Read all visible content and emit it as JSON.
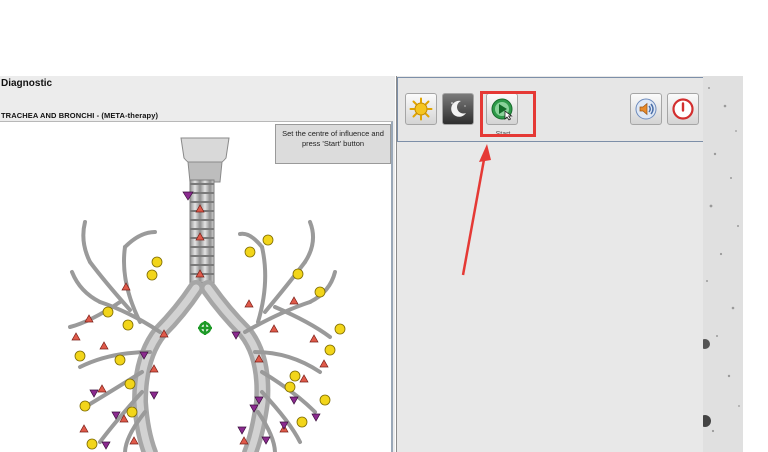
{
  "window": {
    "title": "Diagnostic",
    "subtitle": "TRACHEA AND BRONCHI - (META-therapy)"
  },
  "hint": {
    "line1": "Set the centre of influence and",
    "line2": "press 'Start' button"
  },
  "toolbar": {
    "start_label": "Start",
    "icons": [
      "sun-icon",
      "moon-icon",
      "start-icon",
      "sound-icon",
      "power-icon"
    ]
  },
  "colors": {
    "annotation_red": "#e53935",
    "marker_red": "#e05a4a",
    "marker_yellow": "#f2d51a",
    "marker_purple": "#8b2a8f",
    "center_marker": "#1e9a28"
  }
}
